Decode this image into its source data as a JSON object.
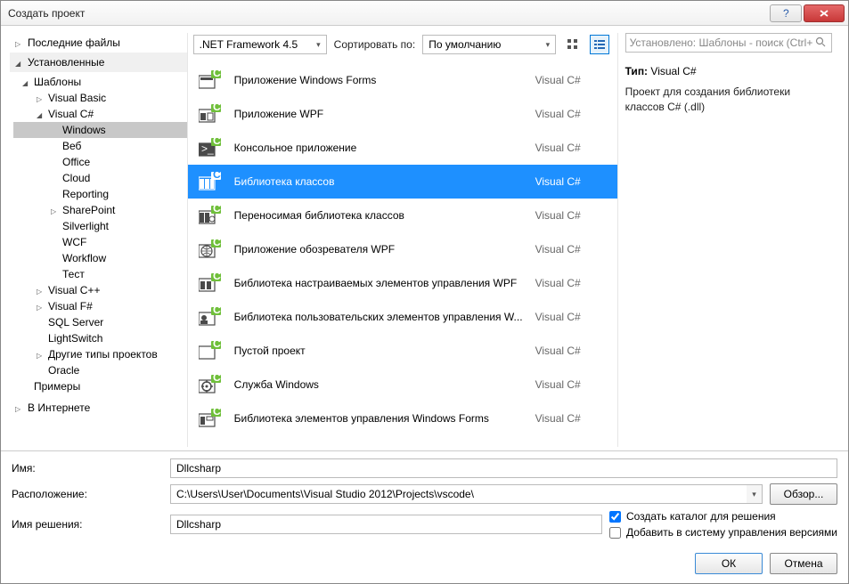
{
  "window": {
    "title": "Создать проект"
  },
  "sidebar": {
    "recent_label": "Последние файлы",
    "installed_label": "Установленные",
    "online_label": "В Интернете",
    "tree": [
      {
        "label": "Шаблоны",
        "indent": 0,
        "arrow": "open",
        "name": "tree-templates"
      },
      {
        "label": "Visual Basic",
        "indent": 1,
        "arrow": "closed",
        "name": "tree-visual-basic"
      },
      {
        "label": "Visual C#",
        "indent": 1,
        "arrow": "open",
        "name": "tree-visual-csharp"
      },
      {
        "label": "Windows",
        "indent": 2,
        "arrow": "",
        "name": "tree-windows",
        "selected": true
      },
      {
        "label": "Веб",
        "indent": 2,
        "arrow": "",
        "name": "tree-web"
      },
      {
        "label": "Office",
        "indent": 2,
        "arrow": "",
        "name": "tree-office"
      },
      {
        "label": "Cloud",
        "indent": 2,
        "arrow": "",
        "name": "tree-cloud"
      },
      {
        "label": "Reporting",
        "indent": 2,
        "arrow": "",
        "name": "tree-reporting"
      },
      {
        "label": "SharePoint",
        "indent": 2,
        "arrow": "closed",
        "name": "tree-sharepoint"
      },
      {
        "label": "Silverlight",
        "indent": 2,
        "arrow": "",
        "name": "tree-silverlight"
      },
      {
        "label": "WCF",
        "indent": 2,
        "arrow": "",
        "name": "tree-wcf"
      },
      {
        "label": "Workflow",
        "indent": 2,
        "arrow": "",
        "name": "tree-workflow"
      },
      {
        "label": "Тест",
        "indent": 2,
        "arrow": "",
        "name": "tree-test"
      },
      {
        "label": "Visual C++",
        "indent": 1,
        "arrow": "closed",
        "name": "tree-visual-cpp"
      },
      {
        "label": "Visual F#",
        "indent": 1,
        "arrow": "closed",
        "name": "tree-visual-fsharp"
      },
      {
        "label": "SQL Server",
        "indent": 1,
        "arrow": "",
        "name": "tree-sql-server"
      },
      {
        "label": "LightSwitch",
        "indent": 1,
        "arrow": "",
        "name": "tree-lightswitch"
      },
      {
        "label": "Другие типы проектов",
        "indent": 1,
        "arrow": "closed",
        "name": "tree-other-project-types"
      },
      {
        "label": "Oracle",
        "indent": 1,
        "arrow": "",
        "name": "tree-oracle"
      },
      {
        "label": "Примеры",
        "indent": 0,
        "arrow": "",
        "name": "tree-samples"
      }
    ]
  },
  "toolbar": {
    "framework": ".NET Framework 4.5",
    "sort_label": "Сортировать по:",
    "sort_value": "По умолчанию"
  },
  "templates": [
    {
      "name": "Приложение Windows Forms",
      "lang": "Visual C#",
      "icon": "winforms"
    },
    {
      "name": "Приложение WPF",
      "lang": "Visual C#",
      "icon": "wpf"
    },
    {
      "name": "Консольное приложение",
      "lang": "Visual C#",
      "icon": "console"
    },
    {
      "name": "Библиотека классов",
      "lang": "Visual C#",
      "icon": "classlib",
      "selected": true
    },
    {
      "name": "Переносимая библиотека классов",
      "lang": "Visual C#",
      "icon": "portable"
    },
    {
      "name": "Приложение обозревателя WPF",
      "lang": "Visual C#",
      "icon": "wpfbrowser"
    },
    {
      "name": "Библиотека настраиваемых элементов управления WPF",
      "lang": "Visual C#",
      "icon": "wpfcustom"
    },
    {
      "name": "Библиотека пользовательских элементов управления W...",
      "lang": "Visual C#",
      "icon": "wpfuser"
    },
    {
      "name": "Пустой проект",
      "lang": "Visual C#",
      "icon": "empty"
    },
    {
      "name": "Служба Windows",
      "lang": "Visual C#",
      "icon": "service"
    },
    {
      "name": "Библиотека элементов управления Windows Forms",
      "lang": "Visual C#",
      "icon": "formsctrl"
    }
  ],
  "details": {
    "search_placeholder": "Установлено: Шаблоны - поиск (Ctrl+",
    "type_label": "Тип:",
    "type_value": "Visual C#",
    "description": "Проект для создания библиотеки классов C# (.dll)"
  },
  "form": {
    "name_label": "Имя:",
    "name_value": "Dllcsharp",
    "location_label": "Расположение:",
    "location_value": "C:\\Users\\User\\Documents\\Visual Studio 2012\\Projects\\vscode\\",
    "solution_label": "Имя решения:",
    "solution_value": "Dllcsharp",
    "browse_label": "Обзор...",
    "check_createdir": "Создать каталог для решения",
    "check_sourcecontrol": "Добавить в систему управления версиями"
  },
  "buttons": {
    "ok": "ОК",
    "cancel": "Отмена"
  }
}
